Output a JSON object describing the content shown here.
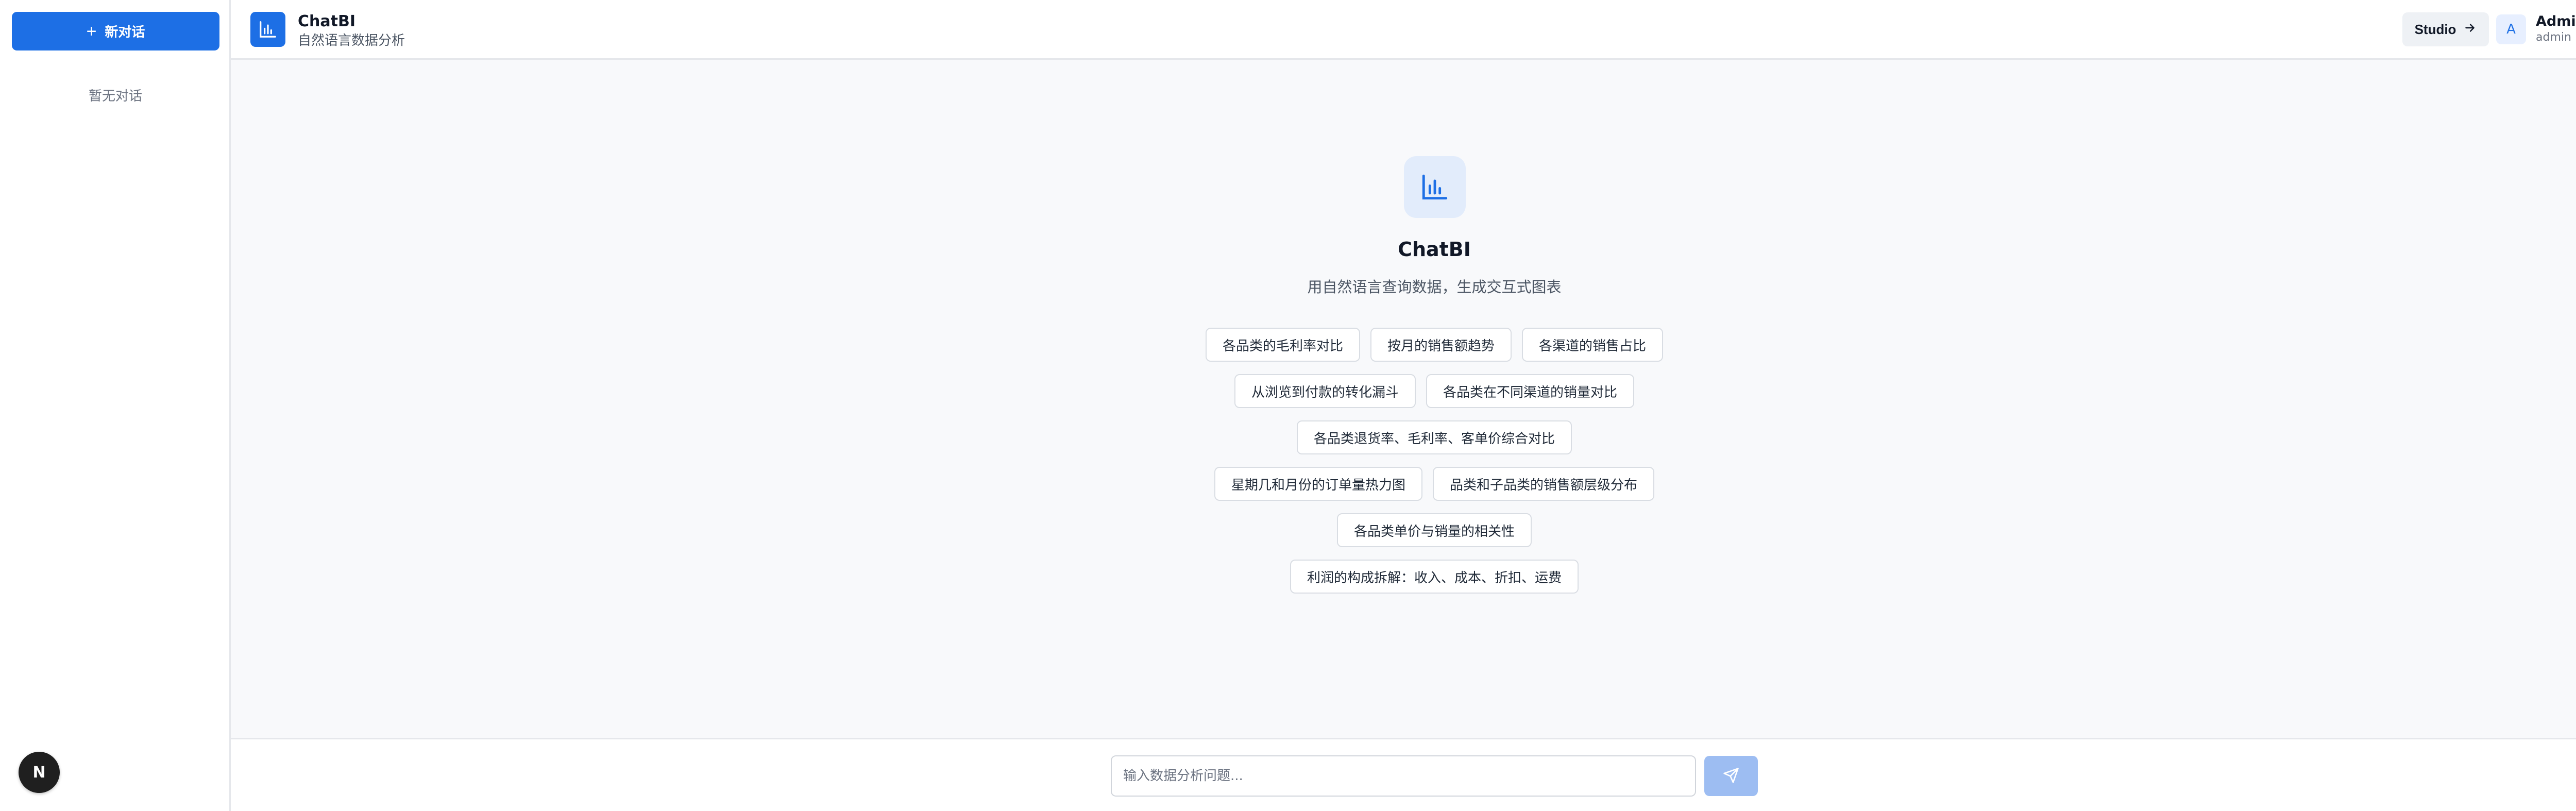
{
  "sidebar": {
    "new_chat_label": "新对话",
    "empty_text": "暂无对话",
    "badge_letter": "N"
  },
  "header": {
    "title": "ChatBI",
    "subtitle": "自然语言数据分析",
    "studio_label": "Studio",
    "user": {
      "avatar_letter": "A",
      "name": "Admin",
      "role": "admin"
    }
  },
  "main": {
    "title": "ChatBI",
    "subtitle": "用自然语言查询数据，生成交互式图表",
    "suggestion_rows": [
      [
        "各品类的毛利率对比",
        "按月的销售额趋势",
        "各渠道的销售占比"
      ],
      [
        "从浏览到付款的转化漏斗",
        "各品类在不同渠道的销量对比"
      ],
      [
        "各品类退货率、毛利率、客单价综合对比"
      ],
      [
        "星期几和月份的订单量热力图",
        "品类和子品类的销售额层级分布"
      ],
      [
        "各品类单价与销量的相关性"
      ],
      [
        "利润的构成拆解：收入、成本、折扣、运费"
      ]
    ]
  },
  "input": {
    "placeholder": "输入数据分析问题..."
  },
  "colors": {
    "primary": "#1d6fe5",
    "send_disabled": "#9dbdf2",
    "main_bg": "#f8f9fb"
  },
  "icons": {
    "logo": "bar-chart-icon",
    "studio": "arrow-right-icon",
    "logout": "logout-icon",
    "send": "send-icon"
  }
}
